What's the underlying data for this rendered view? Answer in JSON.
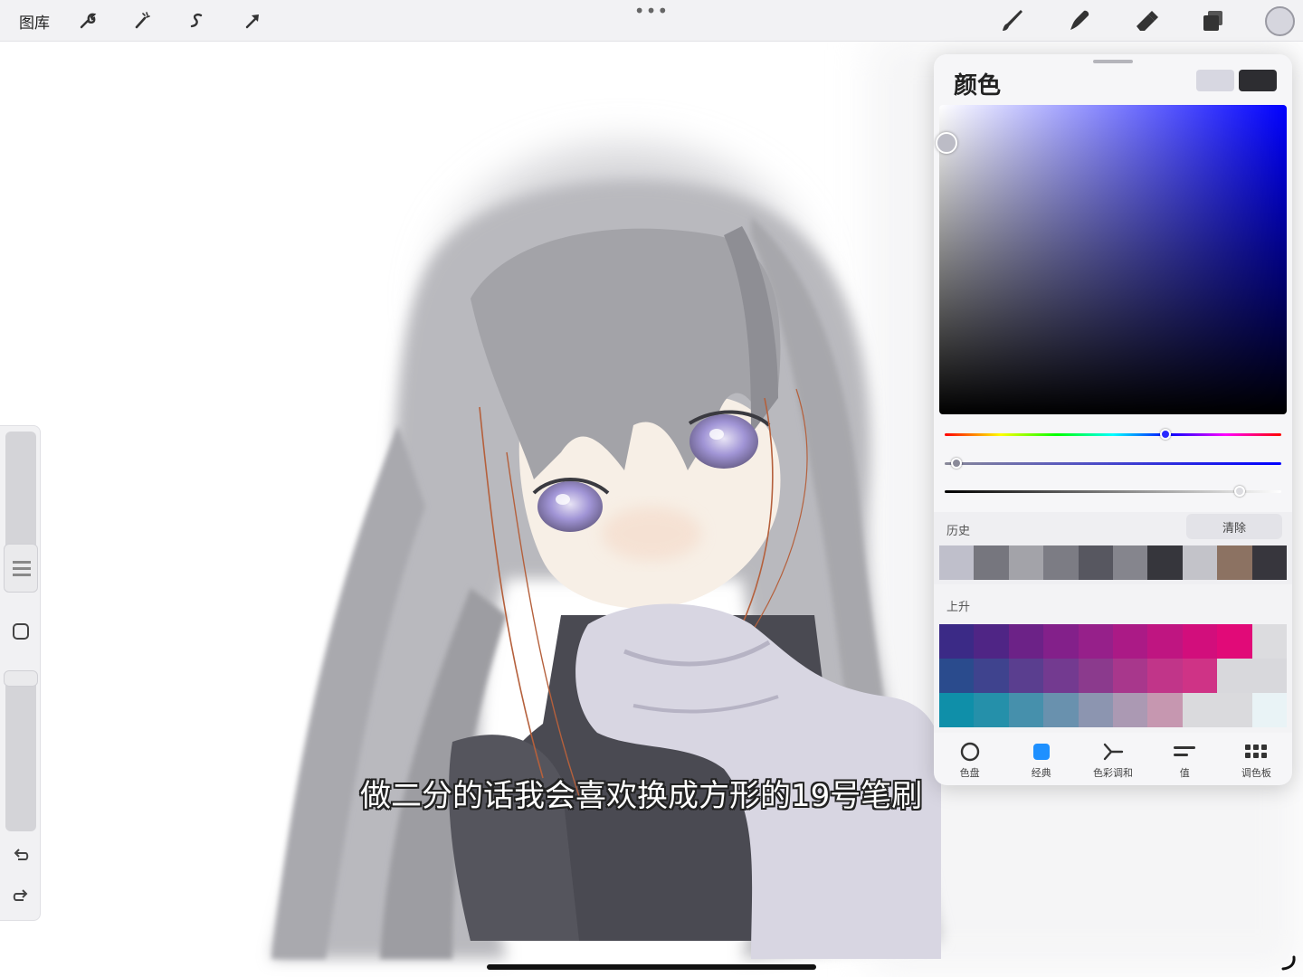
{
  "topbar": {
    "gallery_label": "图库",
    "more_label": "•••",
    "icons": [
      "wrench-icon",
      "magic-wand-icon",
      "selection-s-icon",
      "transform-arrow-icon",
      "brush-icon",
      "smudge-icon",
      "eraser-icon",
      "layers-icon"
    ]
  },
  "subtitle": "做二分的话我会喜欢换成方形的19号笔刷",
  "color_panel": {
    "title": "颜色",
    "primary_color": "#2d2d31",
    "secondary_color": "#d7d7e1",
    "hue": 0.66,
    "history": {
      "label": "历史",
      "clear_label": "清除",
      "swatches": [
        "#bfbfcb",
        "#76767e",
        "#a3a3a9",
        "#7c7c84",
        "#575760",
        "#85858d",
        "#36363c",
        "#c3c3c9",
        "#8c7262",
        "#37363d"
      ]
    },
    "palette": {
      "label": "上升",
      "swatches": [
        "#3b2a86",
        "#4f2585",
        "#6c2287",
        "#83208a",
        "#96208a",
        "#ab1a86",
        "#bf1581",
        "#d20e7c",
        "#e10a78",
        "#dcdcdf",
        "#2a4b8d",
        "#3f438e",
        "#5a3e8f",
        "#733a90",
        "#8b3a8d",
        "#a8378c",
        "#c13589",
        "#cf3386",
        "#d8d8dc",
        "#d8d8dc",
        "#0f8fa9",
        "#2590aa",
        "#4690ac",
        "#6991ae",
        "#8c95b0",
        "#ab99b3",
        "#c697b0",
        "#dadadd",
        "#dadadd",
        "#e9f3f6"
      ]
    },
    "tabs": [
      {
        "label": "色盘",
        "icon": "disc-icon"
      },
      {
        "label": "经典",
        "icon": "classic-square-icon"
      },
      {
        "label": "色彩调和",
        "icon": "harmony-icon"
      },
      {
        "label": "值",
        "icon": "value-sliders-icon"
      },
      {
        "label": "调色板",
        "icon": "palettes-grid-icon"
      }
    ]
  }
}
